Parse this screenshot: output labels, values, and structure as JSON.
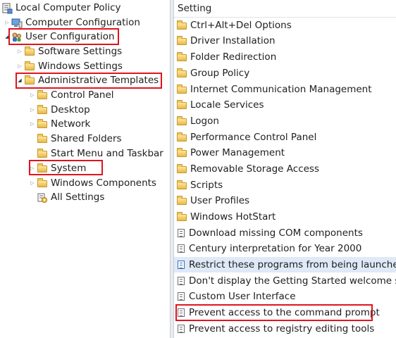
{
  "tree": {
    "root": "Local Computer Policy",
    "computer_config": "Computer Configuration",
    "user_config": "User Configuration",
    "software_settings": "Software Settings",
    "windows_settings": "Windows Settings",
    "admin_templates": "Administrative Templates",
    "control_panel": "Control Panel",
    "desktop": "Desktop",
    "network": "Network",
    "shared_folders": "Shared Folders",
    "start_menu": "Start Menu and Taskbar",
    "system": "System",
    "windows_components": "Windows Components",
    "all_settings": "All Settings"
  },
  "list": {
    "header": "Setting",
    "folders": [
      "Ctrl+Alt+Del Options",
      "Driver Installation",
      "Folder Redirection",
      "Group Policy",
      "Internet Communication Management",
      "Locale Services",
      "Logon",
      "Performance Control Panel",
      "Power Management",
      "Removable Storage Access",
      "Scripts",
      "User Profiles",
      "Windows HotStart"
    ],
    "settings": [
      "Download missing COM components",
      "Century interpretation for Year 2000",
      "Restrict these programs from being launched...",
      "Don't display the Getting Started welcome sc...",
      "Custom User Interface",
      "Prevent access to the command prompt",
      "Prevent access to registry editing tools"
    ]
  },
  "colors": {
    "highlight": "#e0141e",
    "selected_row": "#dfe9f7",
    "folder": "#e8b84a"
  }
}
